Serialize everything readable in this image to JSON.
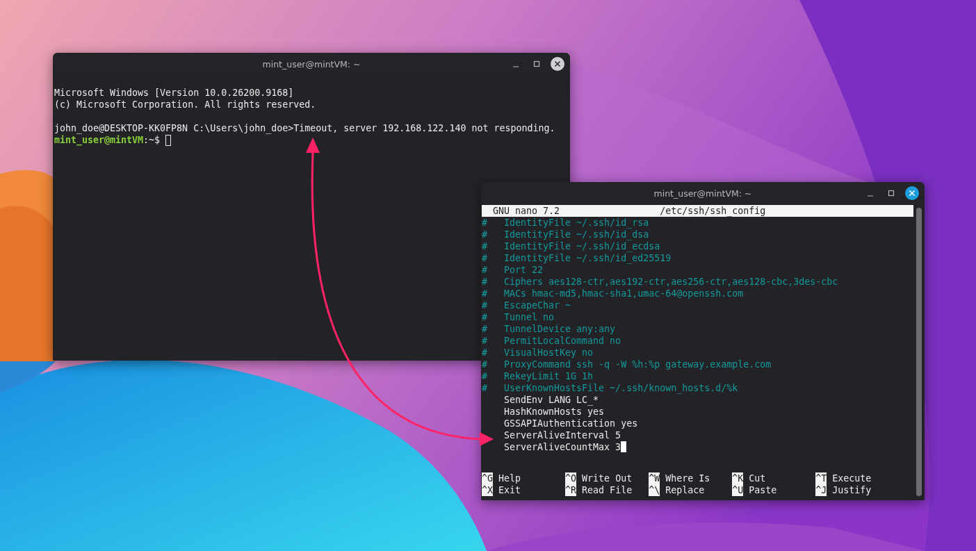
{
  "windows": [
    {
      "title": "mint_user@mintVM: ~",
      "focused": false,
      "kind": "shell",
      "blocks": [
        {
          "lines": [
            {
              "kind": "output",
              "text": "Microsoft Windows [Version 10.0.26200.9168]"
            },
            {
              "kind": "output",
              "text": "(c) Microsoft Corporation. All rights reserved."
            }
          ]
        },
        {
          "lines": [
            {
              "kind": "output",
              "text": "john_doe@DESKTOP-KK0FP8N C:\\Users\\john_doe>Timeout, server 192.168.122.140 not responding."
            },
            {
              "kind": "prompt",
              "user_host": "mint_user@mintVM",
              "text": ":~$"
            }
          ]
        }
      ]
    },
    {
      "title": "mint_user@mintVM: ~",
      "focused": true,
      "kind": "nano",
      "header": {
        "app": "GNU nano 7.2",
        "file": "/etc/ssh/ssh_config"
      },
      "lines": [
        {
          "kind": "comment",
          "marker": "#",
          "text": "IdentityFile ~/.ssh/id_rsa",
          "cursor": false
        },
        {
          "kind": "comment",
          "marker": "#",
          "text": "IdentityFile ~/.ssh/id_dsa",
          "cursor": false
        },
        {
          "kind": "comment",
          "marker": "#",
          "text": "IdentityFile ~/.ssh/id_ecdsa",
          "cursor": false
        },
        {
          "kind": "comment",
          "marker": "#",
          "text": "IdentityFile ~/.ssh/id_ed25519",
          "cursor": false
        },
        {
          "kind": "comment",
          "marker": "#",
          "text": "Port 22",
          "cursor": false
        },
        {
          "kind": "comment",
          "marker": "#",
          "text": "Ciphers aes128-ctr,aes192-ctr,aes256-ctr,aes128-cbc,3des-cbc",
          "cursor": false
        },
        {
          "kind": "comment",
          "marker": "#",
          "text": "MACs hmac-md5,hmac-sha1,umac-64@openssh.com",
          "cursor": false
        },
        {
          "kind": "comment",
          "marker": "#",
          "text": "EscapeChar ~",
          "cursor": false
        },
        {
          "kind": "comment",
          "marker": "#",
          "text": "Tunnel no",
          "cursor": false
        },
        {
          "kind": "comment",
          "marker": "#",
          "text": "TunnelDevice any:any",
          "cursor": false
        },
        {
          "kind": "comment",
          "marker": "#",
          "text": "PermitLocalCommand no",
          "cursor": false
        },
        {
          "kind": "comment",
          "marker": "#",
          "text": "VisualHostKey no",
          "cursor": false
        },
        {
          "kind": "comment",
          "marker": "#",
          "text": "ProxyCommand ssh -q -W %h:%p gateway.example.com",
          "cursor": false
        },
        {
          "kind": "comment",
          "marker": "#",
          "text": "RekeyLimit 1G 1h",
          "cursor": false
        },
        {
          "kind": "comment",
          "marker": "#",
          "text": "UserKnownHostsFile ~/.ssh/known_hosts.d/%k",
          "cursor": false
        },
        {
          "kind": "setting",
          "text": "SendEnv LANG LC_*",
          "cursor": false
        },
        {
          "kind": "setting",
          "text": "HashKnownHosts yes",
          "cursor": false
        },
        {
          "kind": "setting",
          "text": "GSSAPIAuthentication yes",
          "cursor": false
        },
        {
          "kind": "setting",
          "text": "ServerAliveInterval 5",
          "cursor": false
        },
        {
          "kind": "setting",
          "text": "ServerAliveCountMax 3",
          "cursor": true
        }
      ],
      "shortcuts": [
        {
          "key": "^G",
          "label": "Help"
        },
        {
          "key": "^O",
          "label": "Write Out"
        },
        {
          "key": "^W",
          "label": "Where Is"
        },
        {
          "key": "^K",
          "label": "Cut"
        },
        {
          "key": "^T",
          "label": "Execute"
        },
        {
          "key": "^X",
          "label": "Exit"
        },
        {
          "key": "^R",
          "label": "Read File"
        },
        {
          "key": "^\\",
          "label": "Replace"
        },
        {
          "key": "^U",
          "label": "Paste"
        },
        {
          "key": "^J",
          "label": "Justify"
        }
      ]
    }
  ]
}
